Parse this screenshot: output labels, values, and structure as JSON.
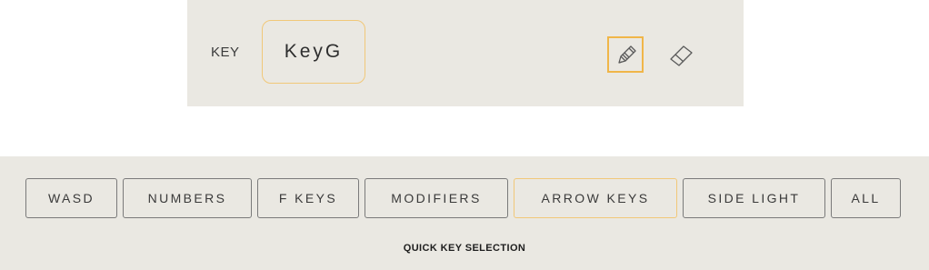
{
  "key_panel": {
    "label": "KEY",
    "value": "KeyG",
    "tools": {
      "pencil_icon": "pencil-icon",
      "eraser_icon": "eraser-icon",
      "active_tool": "pencil"
    }
  },
  "quick_selection": {
    "buttons": [
      {
        "label": "WASD"
      },
      {
        "label": "NUMBERS"
      },
      {
        "label": "F KEYS"
      },
      {
        "label": "MODIFIERS"
      },
      {
        "label": "ARROW KEYS",
        "active": true
      },
      {
        "label": "SIDE LIGHT"
      },
      {
        "label": "ALL"
      }
    ],
    "caption": "QUICK KEY SELECTION"
  },
  "colors": {
    "panel_bg": "#eae8e2",
    "accent": "#f0b649",
    "border": "#7a7a7a"
  }
}
